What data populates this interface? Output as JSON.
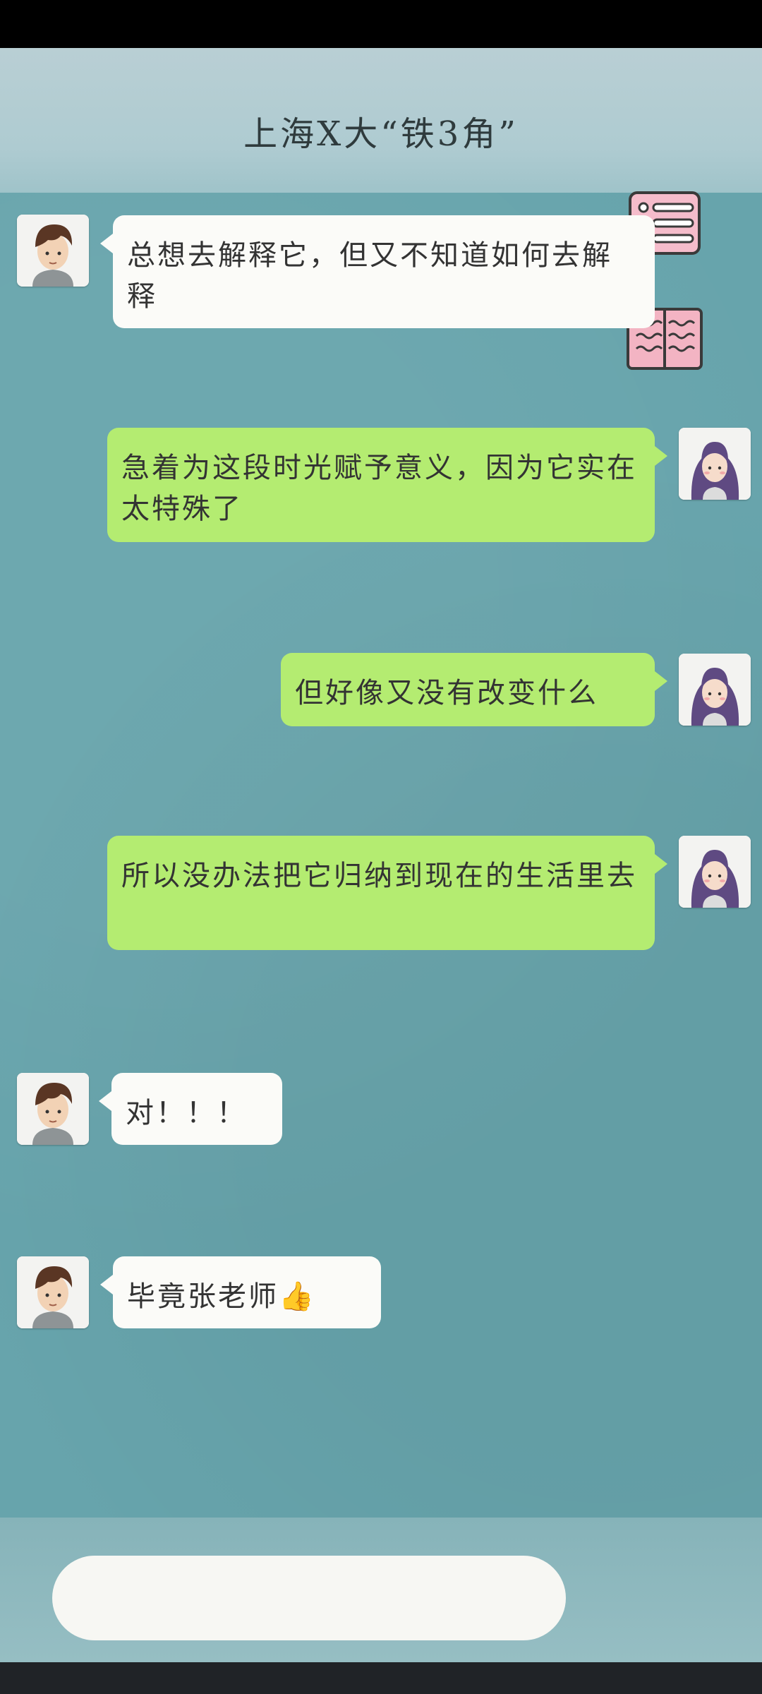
{
  "header": {
    "title": "上海X大“铁3角”"
  },
  "messages": [
    {
      "sender": "male",
      "text": "总想去解释它，但又不知道如何去解释"
    },
    {
      "sender": "self-female",
      "text": "急着为这段时光赋予意义，因为它实在太特殊了"
    },
    {
      "sender": "self-female",
      "text": "但好像又没有改变什么"
    },
    {
      "sender": "self-female",
      "text": "所以没办法把它归纳到现在的生活里去"
    },
    {
      "sender": "male",
      "text": "对！！！"
    },
    {
      "sender": "male",
      "text": "毕竟张老师👍"
    }
  ],
  "side_buttons": {
    "list_icon": "list-icon",
    "book_icon": "book-icon"
  },
  "input": {
    "value": ""
  },
  "colors": {
    "background": "#67a4ac",
    "incoming_bubble": "#fbfbf8",
    "outgoing_bubble": "#b4ec71",
    "list_icon": "#f2b8c6"
  }
}
